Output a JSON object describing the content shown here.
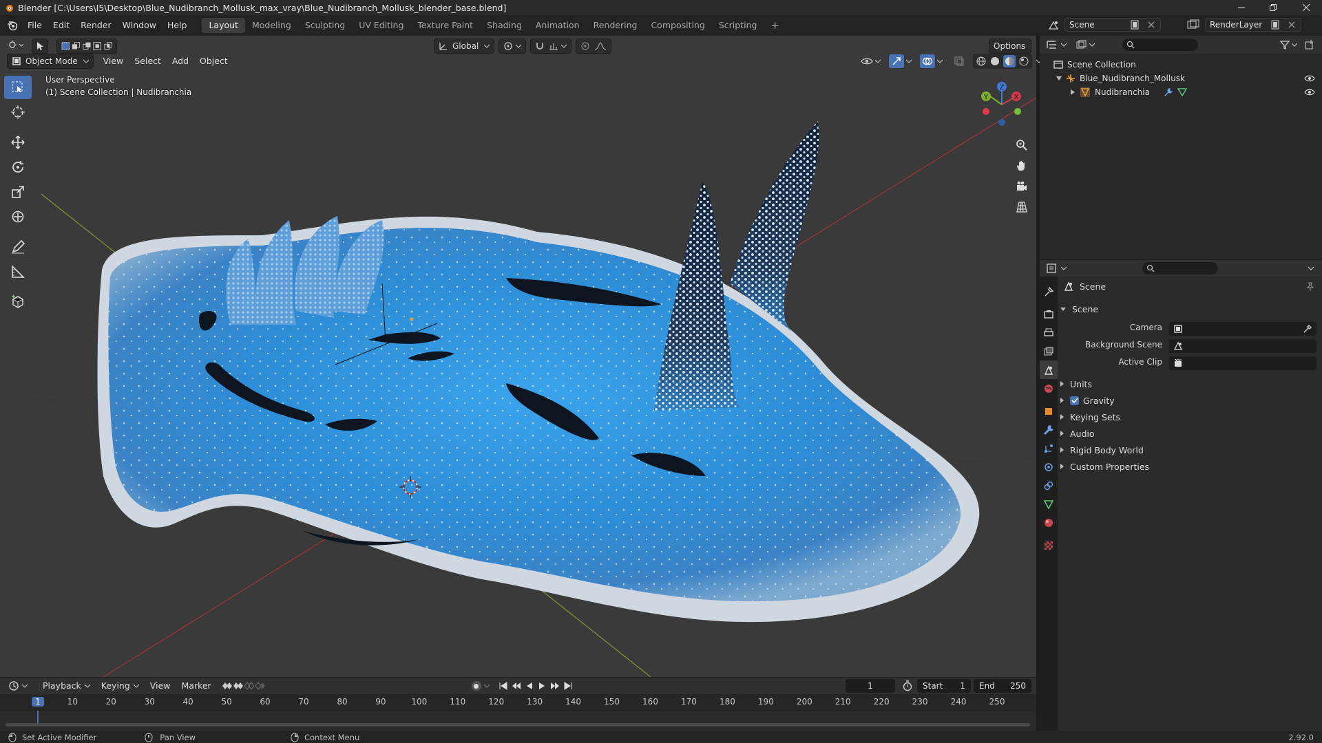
{
  "window": {
    "title": "Blender [C:\\Users\\I5\\Desktop\\Blue_Nudibranch_Mollusk_max_vray\\Blue_Nudibranch_Mollusk_blender_base.blend]"
  },
  "menus": [
    "File",
    "Edit",
    "Render",
    "Window",
    "Help"
  ],
  "workspaces": [
    "Layout",
    "Modeling",
    "Sculpting",
    "UV Editing",
    "Texture Paint",
    "Shading",
    "Animation",
    "Rendering",
    "Compositing",
    "Scripting"
  ],
  "header_right": {
    "scene": "Scene",
    "render_layer": "RenderLayer"
  },
  "viewport": {
    "mode": "Object Mode",
    "menus": [
      "View",
      "Select",
      "Add",
      "Object"
    ],
    "transform_orientation": "Global",
    "options_label": "Options",
    "info_line1": "User Perspective",
    "info_line2": "(1) Scene Collection | Nudibranchia",
    "gizmo_labels": {
      "z": "Z",
      "y": "Y",
      "x": "X"
    }
  },
  "outliner": {
    "root": "Scene Collection",
    "items": [
      {
        "label": "Blue_Nudibranch_Mollusk"
      },
      {
        "label": "Nudibranchia"
      }
    ]
  },
  "properties": {
    "context_title": "Scene",
    "section_title": "Scene",
    "fields": [
      {
        "label": "Camera",
        "value": ""
      },
      {
        "label": "Background Scene",
        "value": ""
      },
      {
        "label": "Active Clip",
        "value": ""
      }
    ],
    "panels": [
      "Units",
      "Gravity",
      "Keying Sets",
      "Audio",
      "Rigid Body World",
      "Custom Properties"
    ],
    "gravity_checked": true
  },
  "timeline": {
    "menus": [
      "Playback",
      "Keying",
      "View",
      "Marker"
    ],
    "current_frame": "1",
    "start_label": "Start",
    "start": "1",
    "end_label": "End",
    "end": "250",
    "ticks": [
      "1",
      "10",
      "20",
      "30",
      "40",
      "50",
      "60",
      "70",
      "80",
      "90",
      "100",
      "110",
      "120",
      "130",
      "140",
      "150",
      "160",
      "170",
      "180",
      "190",
      "200",
      "210",
      "220",
      "230",
      "240",
      "250"
    ]
  },
  "statusbar": {
    "left": "Set Active Modifier",
    "middle": "Pan View",
    "right": "Context Menu",
    "version": "2.92.0"
  },
  "colors": {
    "accent": "#4772b3",
    "axis_x": "#b8303a",
    "axis_y": "#7fa82a",
    "slug_body": "#2f8fd8",
    "slug_edge": "#d8dde6"
  }
}
